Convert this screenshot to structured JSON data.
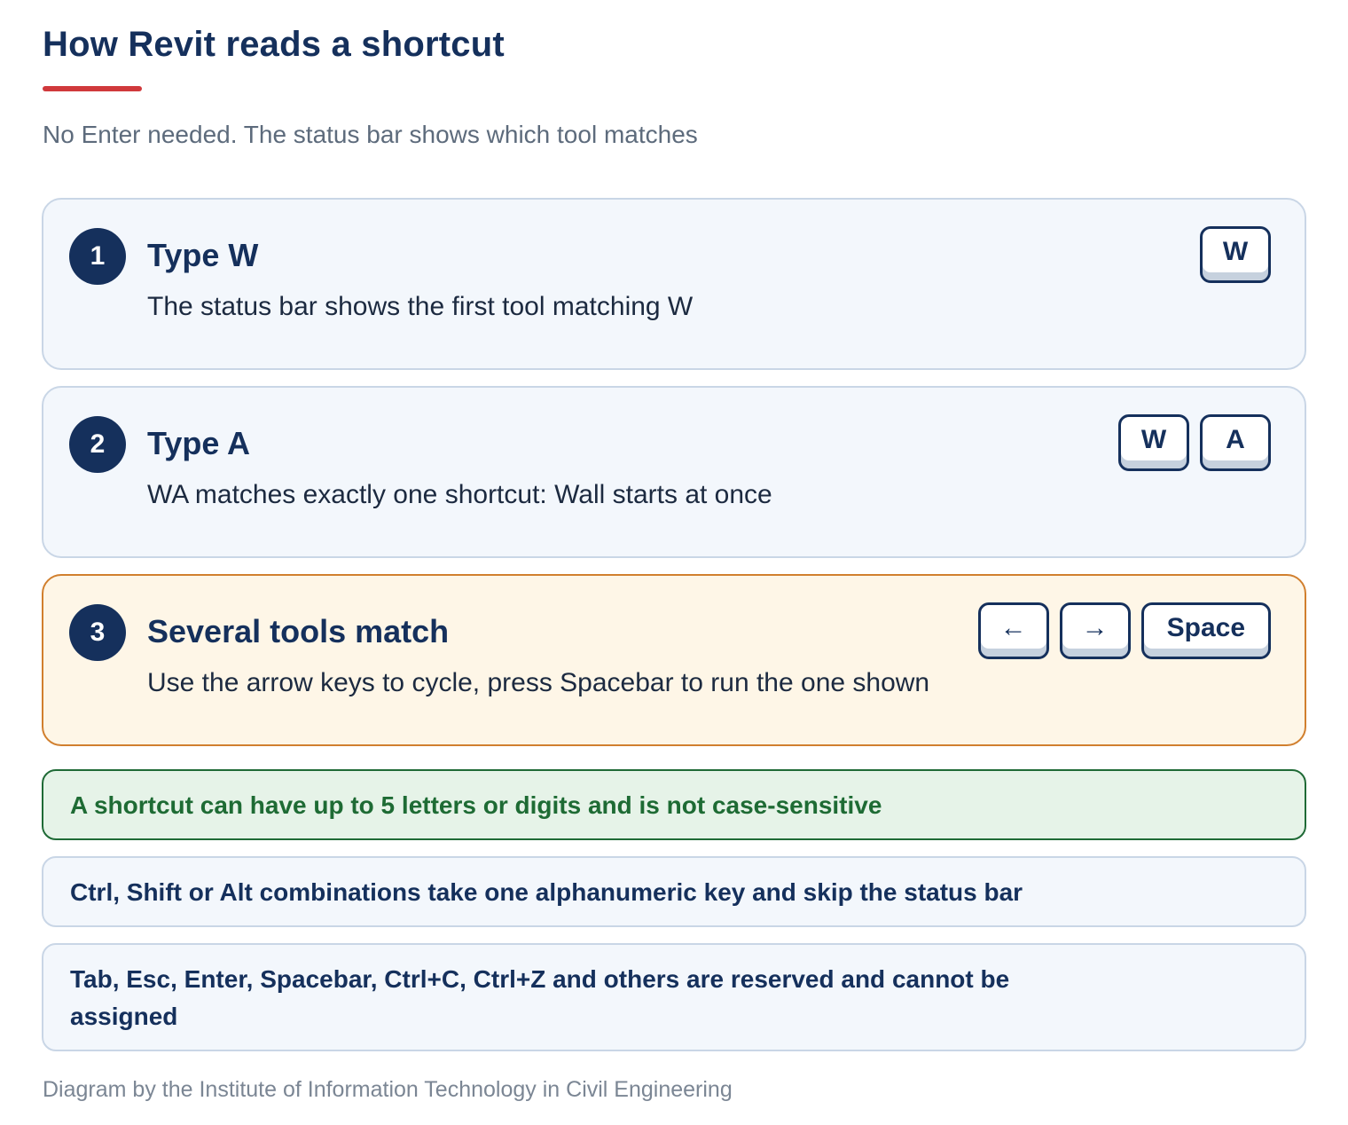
{
  "header": {
    "title": "How Revit reads a shortcut",
    "subtitle": "No Enter needed. The status bar shows which tool matches"
  },
  "steps": [
    {
      "number": "1",
      "title": "Type W",
      "description": "The status bar shows the first tool matching W",
      "keys": [
        "W"
      ]
    },
    {
      "number": "2",
      "title": "Type A",
      "description": "WA matches exactly one shortcut: Wall starts at once",
      "keys": [
        "W",
        "A"
      ]
    },
    {
      "number": "3",
      "title": "Several tools match",
      "description": "Use the arrow keys to cycle, press Spacebar to run the one shown",
      "keys": [
        "←",
        "→",
        "Space"
      ]
    }
  ],
  "notes": {
    "success": "A shortcut can have up to 5 letters or digits and is not case-sensitive",
    "modifiers": "Ctrl, Shift or Alt combinations take one alphanumeric key and skip the status bar",
    "reserved": "Tab, Esc, Enter, Spacebar, Ctrl+C, Ctrl+Z and others are reserved and cannot be assigned"
  },
  "footer": "Diagram by the Institute of Information Technology in Civil Engineering",
  "colors": {
    "navy": "#15305c",
    "accent_red": "#d0393c",
    "highlight_border": "#d17f2e",
    "highlight_bg": "#fef6e7",
    "success_border": "#1f6a36",
    "success_bg": "#e6f3e8"
  }
}
